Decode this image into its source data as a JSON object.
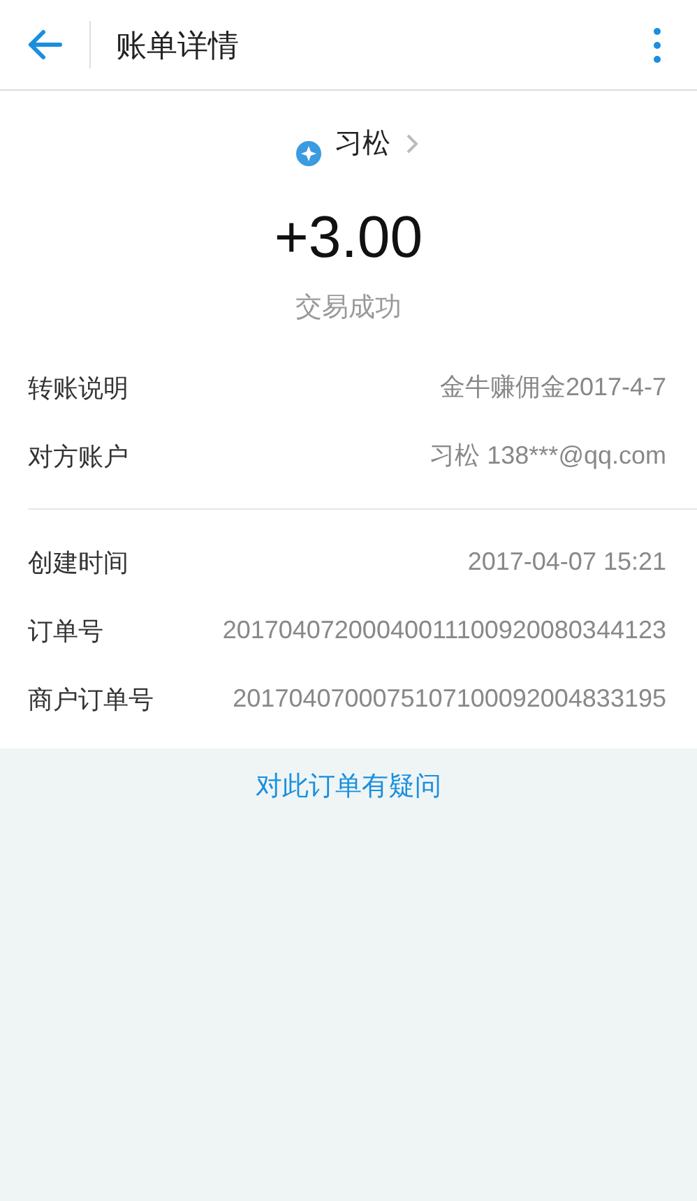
{
  "header": {
    "title": "账单详情"
  },
  "payee": {
    "name": "习松"
  },
  "amount": "+3.00",
  "status": "交易成功",
  "detail_groups": [
    [
      {
        "label": "转账说明",
        "value": "金牛赚佣金2017-4-7"
      },
      {
        "label": "对方账户",
        "value": "习松 138***@qq.com"
      }
    ],
    [
      {
        "label": "创建时间",
        "value": "2017-04-07 15:21"
      },
      {
        "label": "订单号",
        "value": "20170407200040011100920080344123"
      },
      {
        "label": "商户订单号",
        "value": "2017040700075107100092004833195"
      }
    ]
  ],
  "question_link": "对此订单有疑问"
}
